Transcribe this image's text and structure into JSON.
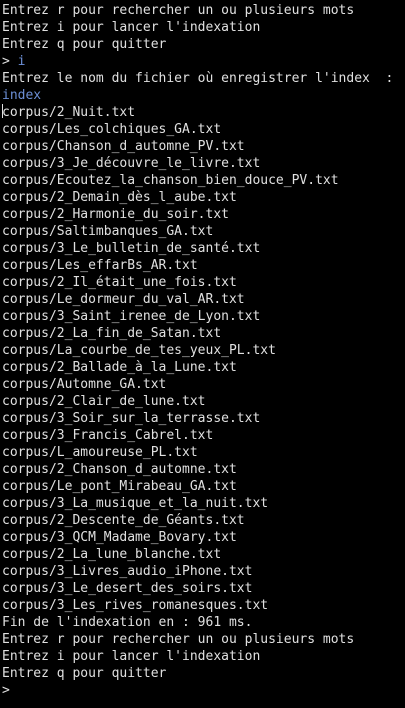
{
  "colors": {
    "background": "#000000",
    "text": "#e0e0e0",
    "user_input": "#6c8fd6"
  },
  "menu_top": [
    "Entrez r pour rechercher un ou plusieurs mots",
    "Entrez i pour lancer l'indexation",
    "Entrez q pour quitter"
  ],
  "prompt_1": {
    "symbol": "> ",
    "input": "i"
  },
  "index_question": "Entrez le nom du fichier où enregistrer l'index  :",
  "index_answer": "index",
  "files": [
    "corpus/2_Nuit.txt",
    "corpus/Les_colchiques_GA.txt",
    "corpus/Chanson_d_automne_PV.txt",
    "corpus/3_Je_découvre_le_livre.txt",
    "corpus/Ecoutez_la_chanson_bien_douce_PV.txt",
    "corpus/2_Demain_dès_l_aube.txt",
    "corpus/2_Harmonie_du_soir.txt",
    "corpus/Saltimbanques_GA.txt",
    "corpus/3_Le_bulletin_de_santé.txt",
    "corpus/Les_effarBs_AR.txt",
    "corpus/2_Il_était_une_fois.txt",
    "corpus/Le_dormeur_du_val_AR.txt",
    "corpus/3_Saint_irenee_de_Lyon.txt",
    "corpus/2_La_fin_de_Satan.txt",
    "corpus/La_courbe_de_tes_yeux_PL.txt",
    "corpus/2_Ballade_à_la_Lune.txt",
    "corpus/Automne_GA.txt",
    "corpus/2_Clair_de_lune.txt",
    "corpus/3_Soir_sur_la_terrasse.txt",
    "corpus/3_Francis_Cabrel.txt",
    "corpus/L_amoureuse_PL.txt",
    "corpus/2_Chanson_d_automne.txt",
    "corpus/Le_pont_Mirabeau_GA.txt",
    "corpus/3_La_musique_et_la_nuit.txt",
    "corpus/2_Descente_de_Géants.txt",
    "corpus/3_QCM_Madame_Bovary.txt",
    "corpus/2_La_lune_blanche.txt",
    "corpus/3_Livres_audio_iPhone.txt",
    "corpus/3_Le_desert_des_soirs.txt",
    "corpus/3_Les_rives_romanesques.txt"
  ],
  "finish_message": "Fin de l'indexation en : 961 ms.",
  "menu_bottom": [
    "Entrez r pour rechercher un ou plusieurs mots",
    "Entrez i pour lancer l'indexation",
    "Entrez q pour quitter"
  ],
  "prompt_final": {
    "symbol": "> "
  }
}
